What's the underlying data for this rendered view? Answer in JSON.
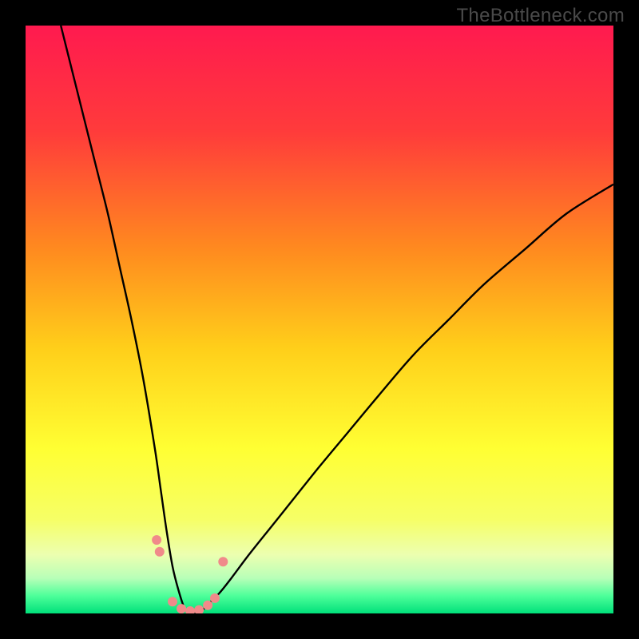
{
  "watermark": "TheBottleneck.com",
  "chart_data": {
    "type": "line",
    "title": "",
    "xlabel": "",
    "ylabel": "",
    "xlim": [
      0,
      100
    ],
    "ylim": [
      0,
      100
    ],
    "grid": false,
    "legend": false,
    "background_gradient": {
      "stops": [
        {
          "offset": 0.0,
          "color": "#ff1a4f"
        },
        {
          "offset": 0.18,
          "color": "#ff3b3b"
        },
        {
          "offset": 0.38,
          "color": "#ff8a1f"
        },
        {
          "offset": 0.55,
          "color": "#ffcf1a"
        },
        {
          "offset": 0.72,
          "color": "#ffff33"
        },
        {
          "offset": 0.84,
          "color": "#f6ff66"
        },
        {
          "offset": 0.9,
          "color": "#ecffb0"
        },
        {
          "offset": 0.94,
          "color": "#b8ffb8"
        },
        {
          "offset": 0.97,
          "color": "#4dff9a"
        },
        {
          "offset": 1.0,
          "color": "#00e07a"
        }
      ]
    },
    "series": [
      {
        "name": "bottleneck-curve",
        "stroke": "#000000",
        "x": [
          6,
          8,
          10,
          12,
          14,
          16,
          18,
          20,
          22,
          23,
          24,
          25,
          26,
          27,
          28,
          29,
          30,
          31,
          33,
          35,
          38,
          42,
          46,
          50,
          55,
          60,
          66,
          72,
          78,
          85,
          92,
          100
        ],
        "y": [
          100,
          92,
          84,
          76,
          68,
          59,
          50,
          40,
          28,
          21,
          14,
          8,
          4,
          1,
          0,
          0,
          0.5,
          1.5,
          3.5,
          6,
          10,
          15,
          20,
          25,
          31,
          37,
          44,
          50,
          56,
          62,
          68,
          73
        ]
      }
    ],
    "markers": {
      "name": "curve-dots-near-min",
      "color": "#f08a8a",
      "radius_px": 6,
      "points": [
        {
          "x": 22.3,
          "y": 12.5
        },
        {
          "x": 22.8,
          "y": 10.5
        },
        {
          "x": 25.0,
          "y": 2.0
        },
        {
          "x": 26.5,
          "y": 0.8
        },
        {
          "x": 28.0,
          "y": 0.4
        },
        {
          "x": 29.5,
          "y": 0.6
        },
        {
          "x": 31.0,
          "y": 1.4
        },
        {
          "x": 32.2,
          "y": 2.6
        },
        {
          "x": 33.6,
          "y": 8.8
        }
      ]
    }
  }
}
